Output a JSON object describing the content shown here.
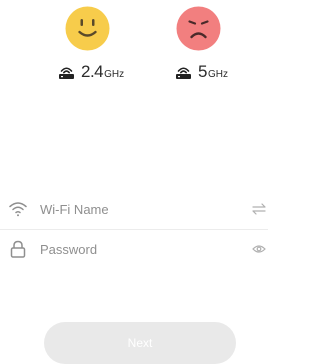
{
  "bands": [
    {
      "value": "2.4",
      "unit": "GHz",
      "face_icon": "smiley-face-icon",
      "face_color": "#f7cc4b",
      "status": "supported"
    },
    {
      "value": "5",
      "unit": "GHz",
      "face_icon": "sad-face-icon",
      "face_color": "#f27f7f",
      "status": "not-supported"
    }
  ],
  "form": {
    "wifi_name": {
      "placeholder": "Wi-Fi Name",
      "value": "",
      "icon": "wifi-icon",
      "action_icon": "switch-network-icon"
    },
    "password": {
      "placeholder": "Password",
      "value": "",
      "icon": "lock-icon",
      "action_icon": "eye-icon"
    }
  },
  "next_button": {
    "label": "Next",
    "enabled": false
  },
  "colors": {
    "text": "#333333",
    "placeholder": "#8f8f8f",
    "button_bg": "#e9e9e9",
    "divider": "#ececec",
    "face_face_eyes": "#5a4a2a"
  }
}
